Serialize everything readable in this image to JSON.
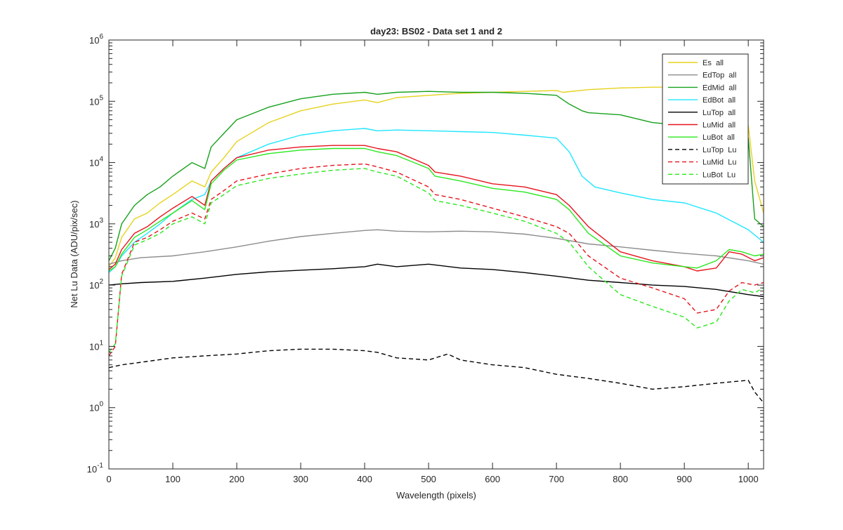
{
  "chart_data": {
    "type": "line",
    "title": "day23: BS02 - Data set 1 and 2",
    "xlabel": "Wavelength (pixels)",
    "ylabel": "Net Lu Data (ADU/pix/sec)",
    "xlim": [
      0,
      1024
    ],
    "ylim": [
      0.1,
      1000000
    ],
    "yscale": "log",
    "grid": false,
    "legend_position": "top-right",
    "x_ticks": [
      0,
      100,
      200,
      300,
      400,
      500,
      600,
      700,
      800,
      900,
      1000
    ],
    "y_ticks": [
      {
        "value": 0.1,
        "base": "10",
        "exp": "-1"
      },
      {
        "value": 1,
        "base": "10",
        "exp": "0"
      },
      {
        "value": 10,
        "base": "10",
        "exp": "1"
      },
      {
        "value": 100,
        "base": "10",
        "exp": "2"
      },
      {
        "value": 1000,
        "base": "10",
        "exp": "3"
      },
      {
        "value": 10000,
        "base": "10",
        "exp": "4"
      },
      {
        "value": 100000,
        "base": "10",
        "exp": "5"
      },
      {
        "value": 1000000,
        "base": "10",
        "exp": "6"
      }
    ],
    "series": [
      {
        "name": "Es  all",
        "color": "#e6d21e",
        "dash": "solid",
        "x": [
          0,
          10,
          20,
          40,
          60,
          80,
          100,
          130,
          150,
          160,
          180,
          200,
          250,
          300,
          350,
          400,
          420,
          450,
          500,
          550,
          600,
          650,
          700,
          710,
          750,
          800,
          850,
          900,
          950,
          980,
          1000,
          1010,
          1024
        ],
        "y": [
          200,
          280,
          600,
          1200,
          1500,
          2200,
          3000,
          5000,
          4000,
          7000,
          12000,
          22000,
          45000,
          70000,
          90000,
          105000,
          95000,
          115000,
          125000,
          135000,
          140000,
          145000,
          150000,
          140000,
          155000,
          165000,
          170000,
          170000,
          165000,
          160000,
          40000,
          5000,
          1500
        ]
      },
      {
        "name": "EdTop  all",
        "color": "#8c8c8c",
        "dash": "solid",
        "x": [
          0,
          20,
          50,
          100,
          150,
          200,
          250,
          300,
          350,
          400,
          420,
          450,
          500,
          550,
          600,
          650,
          700,
          750,
          800,
          850,
          900,
          950,
          1000,
          1024
        ],
        "y": [
          220,
          250,
          280,
          300,
          350,
          420,
          520,
          620,
          700,
          780,
          800,
          760,
          740,
          760,
          740,
          680,
          580,
          470,
          420,
          370,
          330,
          300,
          250,
          220
        ]
      },
      {
        "name": "EdMid  all",
        "color": "#17a11c",
        "dash": "solid",
        "x": [
          0,
          10,
          20,
          40,
          60,
          80,
          100,
          130,
          150,
          160,
          180,
          200,
          250,
          300,
          350,
          400,
          420,
          450,
          500,
          550,
          600,
          650,
          700,
          720,
          740,
          750,
          800,
          850,
          900,
          950,
          1000,
          1010,
          1024
        ],
        "y": [
          250,
          400,
          1000,
          2000,
          3000,
          4000,
          6000,
          10000,
          8000,
          18000,
          30000,
          50000,
          80000,
          110000,
          130000,
          140000,
          130000,
          140000,
          145000,
          140000,
          140000,
          135000,
          125000,
          90000,
          70000,
          65000,
          60000,
          45000,
          40000,
          35000,
          25000,
          1200,
          900
        ]
      },
      {
        "name": "EdBot  all",
        "color": "#1ee6ff",
        "dash": "solid",
        "x": [
          0,
          10,
          20,
          40,
          60,
          80,
          100,
          130,
          150,
          160,
          180,
          200,
          250,
          300,
          350,
          400,
          420,
          450,
          500,
          550,
          600,
          650,
          700,
          720,
          740,
          760,
          800,
          850,
          900,
          950,
          1000,
          1024
        ],
        "y": [
          160,
          200,
          300,
          500,
          700,
          1000,
          1500,
          2500,
          3000,
          5000,
          8000,
          12000,
          20000,
          28000,
          33000,
          36000,
          33000,
          34000,
          33000,
          32000,
          31000,
          28000,
          25000,
          15000,
          6000,
          4000,
          3200,
          2500,
          2200,
          1500,
          800,
          500
        ]
      },
      {
        "name": "LuTop  all",
        "color": "#000000",
        "dash": "solid",
        "x": [
          0,
          20,
          50,
          100,
          150,
          200,
          250,
          300,
          350,
          400,
          420,
          450,
          500,
          550,
          600,
          650,
          700,
          750,
          800,
          850,
          900,
          950,
          1000,
          1024
        ],
        "y": [
          100,
          105,
          110,
          115,
          130,
          150,
          165,
          175,
          185,
          200,
          220,
          200,
          220,
          190,
          180,
          160,
          140,
          120,
          110,
          100,
          95,
          85,
          70,
          65
        ]
      },
      {
        "name": "LuMid  all",
        "color": "#e6141e",
        "dash": "solid",
        "x": [
          0,
          10,
          20,
          40,
          60,
          80,
          100,
          130,
          150,
          160,
          180,
          200,
          250,
          300,
          350,
          400,
          420,
          450,
          500,
          510,
          550,
          600,
          650,
          700,
          720,
          750,
          800,
          850,
          900,
          920,
          950,
          970,
          990,
          1010,
          1024
        ],
        "y": [
          180,
          220,
          380,
          700,
          900,
          1300,
          1800,
          2800,
          2000,
          5000,
          8000,
          12000,
          16000,
          18000,
          19000,
          19000,
          17000,
          15000,
          9000,
          7000,
          6000,
          4500,
          4000,
          3000,
          2000,
          900,
          350,
          250,
          200,
          170,
          190,
          350,
          320,
          250,
          280
        ]
      },
      {
        "name": "LuBot  all",
        "color": "#2ae81e",
        "dash": "solid",
        "x": [
          0,
          10,
          20,
          40,
          60,
          80,
          100,
          130,
          150,
          160,
          180,
          200,
          250,
          300,
          350,
          400,
          420,
          450,
          500,
          510,
          550,
          600,
          650,
          700,
          720,
          750,
          800,
          850,
          900,
          920,
          950,
          970,
          990,
          1010,
          1024
        ],
        "y": [
          170,
          200,
          320,
          600,
          800,
          1100,
          1500,
          2400,
          1700,
          4500,
          7500,
          11000,
          14000,
          16000,
          17000,
          17000,
          15000,
          13000,
          8000,
          6000,
          5000,
          3800,
          3300,
          2500,
          1700,
          700,
          300,
          230,
          200,
          190,
          250,
          380,
          350,
          300,
          320
        ]
      },
      {
        "name": "LuTop  Lu",
        "color": "#000000",
        "dash": "dashed",
        "x": [
          0,
          20,
          50,
          100,
          150,
          200,
          250,
          300,
          350,
          400,
          420,
          450,
          500,
          530,
          550,
          600,
          650,
          700,
          750,
          800,
          850,
          900,
          950,
          1000,
          1010,
          1024
        ],
        "y": [
          4.5,
          5,
          5.5,
          6.5,
          7,
          7.5,
          8.5,
          9,
          9,
          8.5,
          8,
          6.5,
          6,
          7.5,
          6,
          5,
          4.5,
          3.5,
          3,
          2.5,
          2,
          2.2,
          2.5,
          2.8,
          1.8,
          1.2
        ]
      },
      {
        "name": "LuMid  Lu",
        "color": "#e6141e",
        "dash": "dashed",
        "x": [
          0,
          10,
          20,
          40,
          60,
          80,
          100,
          130,
          150,
          160,
          180,
          200,
          250,
          300,
          350,
          400,
          420,
          450,
          500,
          510,
          550,
          600,
          650,
          700,
          720,
          750,
          800,
          850,
          900,
          920,
          950,
          970,
          990,
          1010,
          1024
        ],
        "y": [
          7,
          10,
          150,
          500,
          600,
          800,
          1100,
          1500,
          1200,
          2500,
          3500,
          5000,
          6500,
          8000,
          9000,
          9500,
          8500,
          7000,
          4000,
          3000,
          2500,
          1800,
          1300,
          900,
          700,
          300,
          130,
          90,
          60,
          35,
          40,
          80,
          110,
          100,
          110
        ]
      },
      {
        "name": "LuBot  Lu",
        "color": "#2ae81e",
        "dash": "dashed",
        "x": [
          0,
          10,
          20,
          40,
          60,
          80,
          100,
          130,
          150,
          160,
          180,
          200,
          250,
          300,
          350,
          400,
          420,
          450,
          500,
          510,
          550,
          600,
          650,
          700,
          720,
          750,
          800,
          850,
          900,
          920,
          950,
          970,
          990,
          1010,
          1024
        ],
        "y": [
          8,
          11,
          140,
          450,
          550,
          700,
          1000,
          1300,
          1000,
          2200,
          3000,
          4200,
          5500,
          6500,
          7500,
          8000,
          7000,
          6000,
          3200,
          2400,
          2000,
          1500,
          1100,
          700,
          500,
          200,
          70,
          45,
          30,
          20,
          25,
          55,
          85,
          75,
          90
        ]
      }
    ]
  }
}
